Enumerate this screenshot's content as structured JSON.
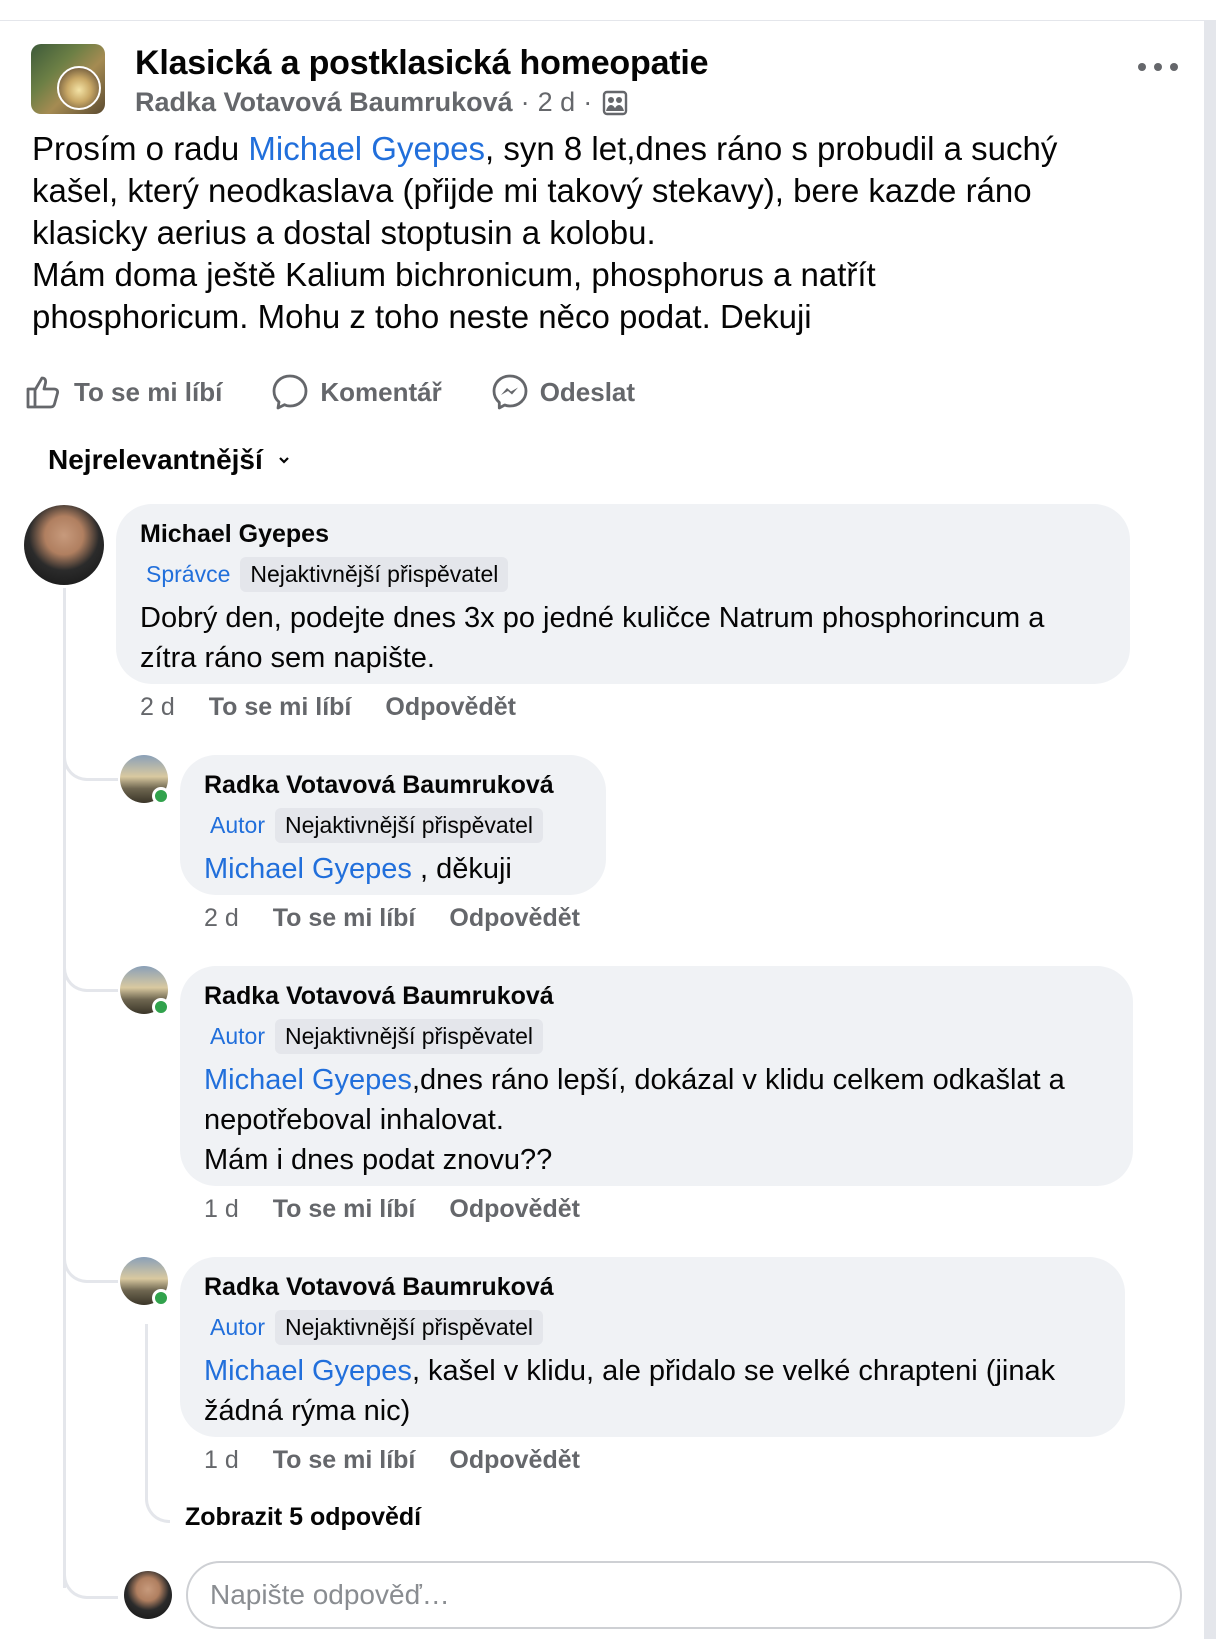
{
  "post": {
    "group_name": "Klasická a postklasická homeopatie",
    "author": "Radka Votavová Baumruková",
    "time": "2 d",
    "separator": "·",
    "audience_icon": "group-members-icon",
    "more_icon": "more-options-icon",
    "body": {
      "line1_pre": "Prosím o radu ",
      "line1_link": "Michael Gyepes",
      "line1_post": ", syn 8 let,dnes ráno s probudil a suchý",
      "line2": "kašel, který neodkaslava (přijde mi takový stekavy), bere kazde ráno",
      "line3": "klasicky aerius a dostal stoptusin a kolobu.",
      "line4": "Mám doma ještě Kalium bichronicum, phosphorus a natřít",
      "line5": "phosphoricum. Mohu z toho neste něco podat. Dekuji"
    }
  },
  "actions": {
    "like": "To se mi líbí",
    "comment": "Komentář",
    "send": "Odeslat"
  },
  "sort": {
    "label": "Nejrelevantnější"
  },
  "comments": [
    {
      "author": "Michael Gyepes",
      "role": "Správce",
      "badge": "Nejaktivnější přispěvatel",
      "lines": [
        "Dobrý den, podejte dnes 3x po jedné kuličce Natrum phosphorincum a",
        "zítra ráno sem napište."
      ],
      "time": "2 d",
      "like": "To se mi líbí",
      "reply": "Odpovědět"
    }
  ],
  "replies": [
    {
      "author": "Radka Votavová Baumruková",
      "role": "Autor",
      "badge": "Nejaktivnější přispěvatel",
      "mention": "Michael Gyepes",
      "lines": [
        " , děkuji"
      ],
      "time": "2 d",
      "like": "To se mi líbí",
      "reply": "Odpovědět"
    },
    {
      "author": "Radka Votavová Baumruková",
      "role": "Autor",
      "badge": "Nejaktivnější přispěvatel",
      "mention": "Michael Gyepes",
      "lines": [
        ",dnes ráno lepší, dokázal v klidu celkem odkašlat a",
        "nepotřeboval inhalovat.",
        "Mám i dnes podat znovu??"
      ],
      "time": "1 d",
      "like": "To se mi líbí",
      "reply": "Odpovědět"
    },
    {
      "author": "Radka Votavová Baumruková",
      "role": "Autor",
      "badge": "Nejaktivnější přispěvatel",
      "mention": "Michael Gyepes",
      "lines": [
        ", kašel v klidu, ale přidalo se velké chrapteni (jinak",
        "žádná rýma nic)"
      ],
      "time": "1 d",
      "like": "To se mi líbí",
      "reply": "Odpovědět"
    }
  ],
  "show_replies": "Zobrazit 5 odpovědí",
  "reply_box": {
    "placeholder": "Napište odpověď…"
  }
}
